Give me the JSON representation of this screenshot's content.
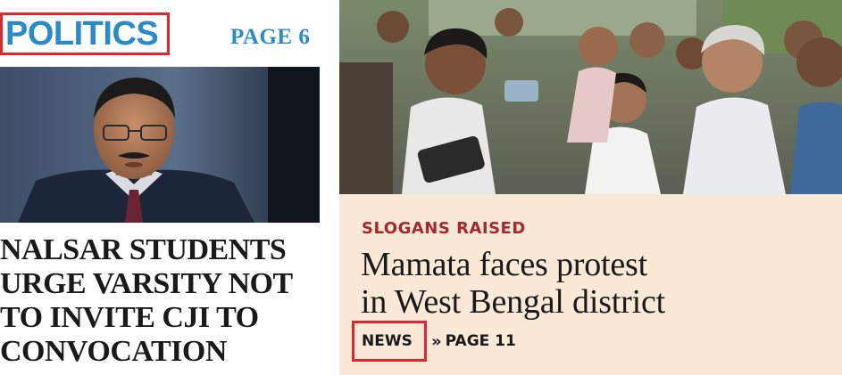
{
  "left": {
    "section_label": "POLITICS",
    "page_ref": "PAGE 6",
    "headline_lines": [
      "NALSAR STUDENTS",
      "URGE VARSITY NOT",
      "TO INVITE CJI TO",
      "CONVOCATION"
    ]
  },
  "right": {
    "kicker": "SLOGANS RAISED",
    "headline_lines": [
      "Mamata faces protest",
      "in West Bengal district"
    ],
    "crumb": {
      "section": "NEWS",
      "separator": "»",
      "page": "PAGE 11"
    }
  },
  "colors": {
    "section_blue": "#2a8bc9",
    "highlight_red": "#e0262b",
    "kicker_red": "#a5282c",
    "right_panel_bg": "#fbe9d8"
  }
}
